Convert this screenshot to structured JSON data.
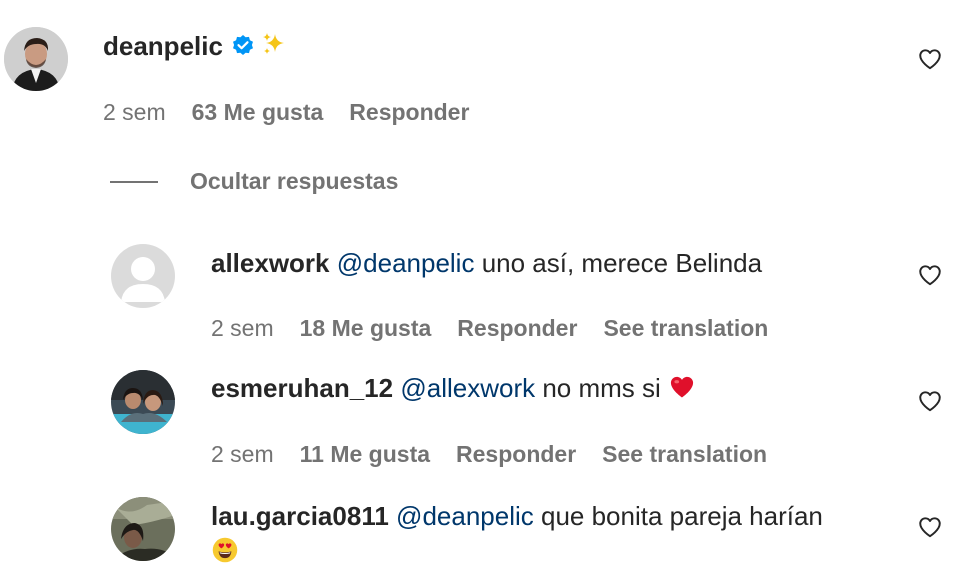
{
  "comments": [
    {
      "username": "deanpelic",
      "verified": true,
      "text": "",
      "emoji_after_username": "sparkles",
      "time": "2 sem",
      "likes": "63 Me gusta",
      "reply": "Responder"
    },
    {
      "username": "allexwork",
      "mention": "@deanpelic",
      "text": " uno así, merece Belinda",
      "time": "2 sem",
      "likes": "18 Me gusta",
      "reply": "Responder",
      "translate": "See translation"
    },
    {
      "username": "esmeruhan_12",
      "mention": "@allexwork",
      "text": " no mms si ",
      "emoji": "red-heart",
      "time": "2 sem",
      "likes": "11 Me gusta",
      "reply": "Responder",
      "translate": "See translation"
    },
    {
      "username": "lau.garcia0811",
      "mention": "@deanpelic",
      "text": " que bonita pareja harían",
      "emoji": "heart-eyes-face"
    }
  ],
  "hide_replies_label": "Ocultar respuestas",
  "colors": {
    "text": "#262626",
    "secondary": "#737373",
    "mention": "#00376b",
    "verified": "#0095f6",
    "heart_emoji": "#e0102b"
  }
}
